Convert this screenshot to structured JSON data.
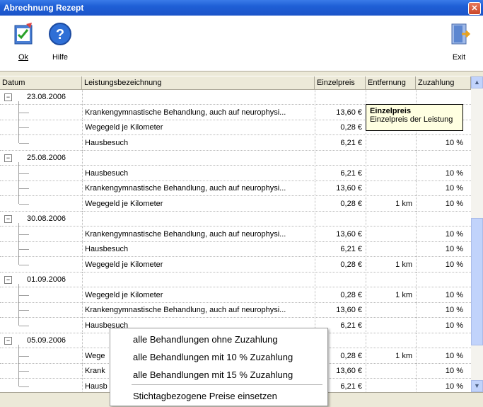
{
  "window": {
    "title": "Abrechnung Rezept"
  },
  "toolbar": {
    "ok_label": "Ok",
    "help_label": "Hilfe",
    "exit_label": "Exit"
  },
  "columns": [
    "Datum",
    "Leistungsbezeichnung",
    "Einzelpreis",
    "Entfernung",
    "Zuzahlung"
  ],
  "groups": [
    {
      "date": "23.08.2006",
      "items": [
        {
          "desc": "Krankengymnastische Behandlung, auch auf neurophysi...",
          "price": "13,60 €",
          "dist": "",
          "zu": ""
        },
        {
          "desc": "Wegegeld je Kilometer",
          "price": "0,28 €",
          "dist": "",
          "zu": ""
        },
        {
          "desc": "Hausbesuch",
          "price": "6,21 €",
          "dist": "",
          "zu": "10 %"
        }
      ]
    },
    {
      "date": "25.08.2006",
      "items": [
        {
          "desc": "Hausbesuch",
          "price": "6,21 €",
          "dist": "",
          "zu": "10 %"
        },
        {
          "desc": "Krankengymnastische Behandlung, auch auf neurophysi...",
          "price": "13,60 €",
          "dist": "",
          "zu": "10 %"
        },
        {
          "desc": "Wegegeld je Kilometer",
          "price": "0,28 €",
          "dist": "1 km",
          "zu": "10 %"
        }
      ]
    },
    {
      "date": "30.08.2006",
      "items": [
        {
          "desc": "Krankengymnastische Behandlung, auch auf neurophysi...",
          "price": "13,60 €",
          "dist": "",
          "zu": "10 %"
        },
        {
          "desc": "Hausbesuch",
          "price": "6,21 €",
          "dist": "",
          "zu": "10 %"
        },
        {
          "desc": "Wegegeld je Kilometer",
          "price": "0,28 €",
          "dist": "1 km",
          "zu": "10 %"
        }
      ]
    },
    {
      "date": "01.09.2006",
      "items": [
        {
          "desc": "Wegegeld je Kilometer",
          "price": "0,28 €",
          "dist": "1 km",
          "zu": "10 %"
        },
        {
          "desc": "Krankengymnastische Behandlung, auch auf neurophysi...",
          "price": "13,60 €",
          "dist": "",
          "zu": "10 %"
        },
        {
          "desc": "Hausbesuch",
          "price": "6,21 €",
          "dist": "",
          "zu": "10 %"
        }
      ]
    },
    {
      "date": "05.09.2006",
      "items": [
        {
          "desc": "Wege",
          "price": "0,28 €",
          "dist": "1 km",
          "zu": "10 %"
        },
        {
          "desc": "Krank",
          "price": "13,60 €",
          "dist": "",
          "zu": "10 %"
        },
        {
          "desc": "Hausb",
          "price": "6,21 €",
          "dist": "",
          "zu": "10 %"
        }
      ]
    }
  ],
  "tooltip": {
    "title": "Einzelpreis",
    "text": "Einzelpreis der Leistung"
  },
  "context_menu": [
    "alle Behandlungen ohne Zuzahlung",
    "alle Behandlungen mit 10 % Zuzahlung",
    "alle Behandlungen mit 15 % Zuzahlung",
    "Stichtagbezogene Preise einsetzen"
  ]
}
